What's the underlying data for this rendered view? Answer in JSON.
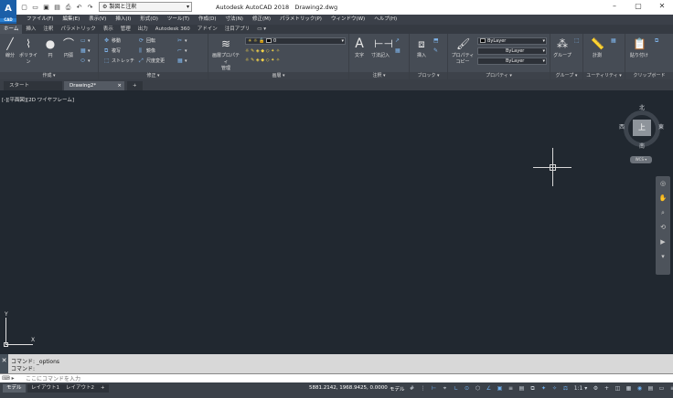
{
  "app": {
    "logo_letter": "A",
    "logo_sub": "CAD",
    "title": "Autodesk AutoCAD 2018",
    "document": "Drawing2.dwg",
    "workspace": "製図と注釈"
  },
  "menu": [
    "ファイル(F)",
    "編集(E)",
    "表示(V)",
    "挿入(I)",
    "形式(O)",
    "ツール(T)",
    "作成(D)",
    "寸法(N)",
    "修正(M)",
    "パラメトリック(P)",
    "ウィンドウ(W)",
    "ヘルプ(H)"
  ],
  "ribbon_tabs": [
    "ホーム",
    "挿入",
    "注釈",
    "パラメトリック",
    "表示",
    "管理",
    "出力",
    "Autodesk 360",
    "アドイン",
    "注目アプリ"
  ],
  "panels": {
    "draw": {
      "title": "作成 ▾",
      "line": "線分",
      "polyline": "ポリライン",
      "circle": "円",
      "arc": "円弧"
    },
    "modify": {
      "title": "修正 ▾",
      "move": "移動",
      "rotate": "回転",
      "copy": "複写",
      "mirror": "鏡像",
      "stretch": "ストレッチ",
      "scale": "尺度変更"
    },
    "layers": {
      "title": "画層 ▾",
      "layer_props": "画層プロパティ\n管理",
      "current_layer": "0"
    },
    "annotation": {
      "title": "注釈 ▾",
      "text": "文字",
      "dimension": "寸法記入"
    },
    "block": {
      "title": "ブロック ▾",
      "insert": "挿入"
    },
    "properties": {
      "title": "プロパティ ▾",
      "match": "プロパティ\nコピー",
      "color": "ByLayer",
      "linetype": "ByLayer",
      "lineweight": "ByLayer"
    },
    "groups": {
      "title": "グループ ▾",
      "group": "グループ"
    },
    "utilities": {
      "title": "ユーティリティ ▾",
      "measure": "計測"
    },
    "clipboard": {
      "title": "クリップボード",
      "paste": "貼り付け"
    }
  },
  "doc_tabs": [
    "スタート",
    "Drawing2*",
    "+"
  ],
  "viewport": {
    "label": "[-][平面図][2D ワイヤフレーム]",
    "viewcube": {
      "face": "上",
      "north": "北",
      "south": "南",
      "east": "東",
      "west": "西",
      "wcs": "WCS ▾"
    },
    "ucs": {
      "x": "X",
      "y": "Y"
    }
  },
  "command": {
    "history": [
      "コマンド: _options",
      "コマンド:"
    ],
    "prefix": "⌨ ▸",
    "placeholder": "ここにコマンドを入力"
  },
  "status": {
    "layout_tabs": [
      "モデル",
      "レイアウト1",
      "レイアウト2",
      "+"
    ],
    "coords": "5881.2142, 1968.9425, 0.0000",
    "space": "モデル",
    "scale": "1:1 ▾"
  }
}
